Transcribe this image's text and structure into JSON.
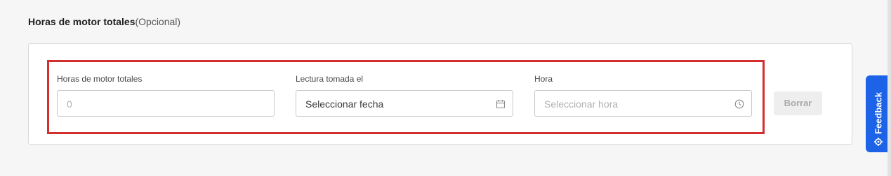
{
  "section": {
    "title": "Horas de motor totales",
    "optional": "(Opcional)"
  },
  "fields": {
    "engine_hours": {
      "label": "Horas de motor totales",
      "placeholder": "0"
    },
    "reading_date": {
      "label": "Lectura tomada el",
      "value": "Seleccionar fecha",
      "icon": "calendar-icon"
    },
    "time": {
      "label": "Hora",
      "placeholder": "Seleccionar hora",
      "icon": "clock-icon"
    }
  },
  "buttons": {
    "clear_label": "Borrar"
  },
  "feedback": {
    "label": "Feedback",
    "icon": "feedback-icon"
  },
  "colors": {
    "highlight": "#d32f2f",
    "feedback_bg": "#1d63e8"
  }
}
